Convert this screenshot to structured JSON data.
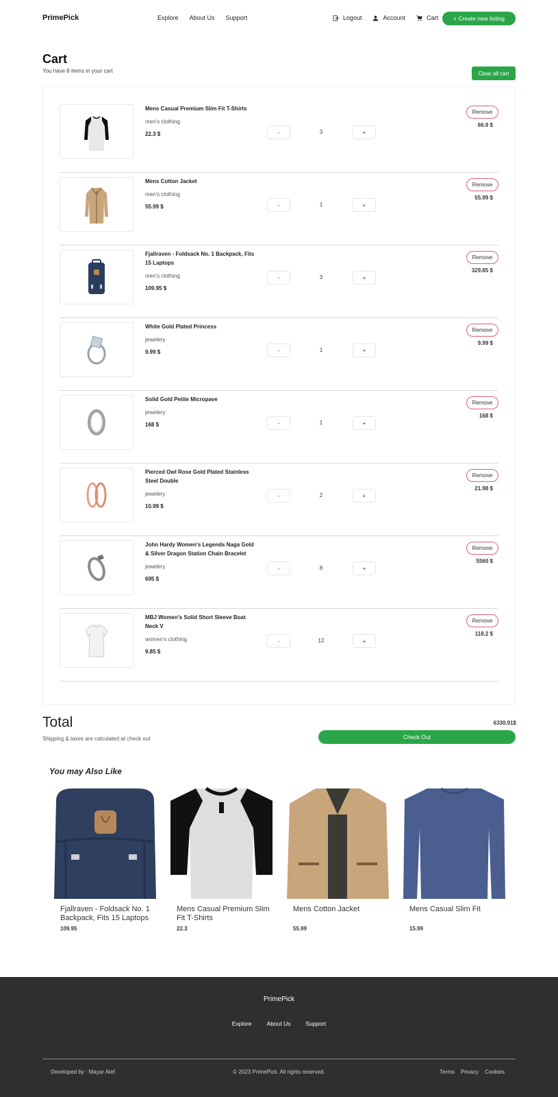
{
  "nav": {
    "brand": "PrimePick",
    "links": [
      "Explore",
      "About Us",
      "Support"
    ],
    "logout": "Logout",
    "account": "Account",
    "cart": "Cart",
    "create": "+ Create new listing"
  },
  "cart": {
    "title": "Cart",
    "subtitle": "You have 8 items in your cart",
    "clear": "Clear all cart",
    "minus": "-",
    "plus": "+",
    "remove": "Remove",
    "items": [
      {
        "name": "Mens Casual Premium Slim Fit T-Shirts",
        "category": "men's clothing",
        "price": "22.3 $",
        "qty": "3",
        "line_total": "66.9 $",
        "icon": "raglan-shirt-icon"
      },
      {
        "name": "Mens Cotton Jacket",
        "category": "men's clothing",
        "price": "55.99 $",
        "qty": "1",
        "line_total": "55.99 $",
        "icon": "jacket-icon"
      },
      {
        "name": "Fjallraven - Foldsack No. 1 Backpack, Fits 15 Laptops",
        "category": "men's clothing",
        "price": "109.95 $",
        "qty": "3",
        "line_total": "329.85 $",
        "icon": "backpack-icon"
      },
      {
        "name": "White Gold Plated Princess",
        "category": "jewelery",
        "price": "9.99 $",
        "qty": "1",
        "line_total": "9.99 $",
        "icon": "ring-icon"
      },
      {
        "name": "Solid Gold Petite Micropave",
        "category": "jewelery",
        "price": "168 $",
        "qty": "1",
        "line_total": "168 $",
        "icon": "band-ring-icon"
      },
      {
        "name": "Pierced Owl Rose Gold Plated Stainless Steel Double",
        "category": "jewelery",
        "price": "10.99 $",
        "qty": "2",
        "line_total": "21.98 $",
        "icon": "rose-gold-rings-icon"
      },
      {
        "name": "John Hardy Women's Legends Naga Gold & Silver Dragon Station Chain Bracelet",
        "category": "jewelery",
        "price": "695 $",
        "qty": "8",
        "line_total": "5560 $",
        "icon": "bracelet-icon"
      },
      {
        "name": "MBJ Women's Solid Short Sleeve Boat Neck V",
        "category": "women's clothing",
        "price": "9.85 $",
        "qty": "12",
        "line_total": "118.2 $",
        "icon": "white-top-icon"
      }
    ]
  },
  "summary": {
    "label": "Total",
    "value": "6330.91$",
    "note": "Shipping & taxes are calculated at check out",
    "checkout": "Check Out"
  },
  "suggestions": {
    "title": "You may Also Like",
    "items": [
      {
        "name": "Fjallraven - Foldsack No. 1 Backpack, Fits 15 Laptops",
        "price": "109.95"
      },
      {
        "name": "Mens Casual Premium Slim Fit T-Shirts",
        "price": "22.3"
      },
      {
        "name": "Mens Cotton Jacket",
        "price": "55.99"
      },
      {
        "name": "Mens Casual Slim Fit",
        "price": "15.99"
      }
    ]
  },
  "footer": {
    "brand": "PrimePick",
    "links": [
      "Explore",
      "About Us",
      "Support"
    ],
    "developer": "Developed by : Mayar Atef",
    "copyright": "© 2023 PrimePick. All rights reserved.",
    "legal": [
      "Terms",
      "Privacy",
      "Cookies"
    ]
  },
  "colors": {
    "accent": "#2aa648",
    "remove_border": "#e06070",
    "footer_bg": "#2f2f2f"
  }
}
